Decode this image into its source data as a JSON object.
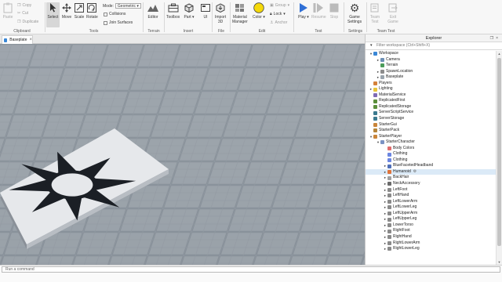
{
  "ribbon": {
    "clipboard": {
      "label": "Clipboard",
      "paste": "Paste",
      "copy": "Copy",
      "cut": "Cut",
      "duplicate": "Duplicate"
    },
    "tools": {
      "label": "Tools",
      "select": "Select",
      "move": "Move",
      "scale": "Scale",
      "rotate": "Rotate",
      "mode_label": "Mode:",
      "mode_value": "Geometric",
      "collisions": "Collisions",
      "join_surfaces": "Join Surfaces"
    },
    "terrain": {
      "label": "Terrain",
      "editor": "Editor"
    },
    "insert": {
      "label": "Insert",
      "toolbox": "Toolbox",
      "part": "Part",
      "ui": "UI"
    },
    "file": {
      "label": "File",
      "import3d_line1": "Import",
      "import3d_line2": "3D"
    },
    "edit": {
      "label": "Edit",
      "material_line1": "Material",
      "material_line2": "Manager",
      "color": "Color",
      "group": "Group",
      "lock": "Lock",
      "anchor": "Anchor"
    },
    "test": {
      "label": "Test",
      "play": "Play",
      "resume": "Resume",
      "stop": "Stop"
    },
    "settings": {
      "label": "Settings",
      "game_line1": "Game",
      "game_line2": "Settings"
    },
    "team_test": {
      "label": "Team Test",
      "team_line1": "Team",
      "team_line2": "Test",
      "exit_line1": "Exit",
      "exit_line2": "Game"
    },
    "colors": {
      "play_blue": "#2f6fd6",
      "color_yellow": "#f5d90a",
      "select_bg": "#d7d7d7"
    }
  },
  "document_tab": {
    "label": "Baseplate"
  },
  "explorer": {
    "title": "Explorer",
    "filter_placeholder": "Filter workspace (Ctrl+Shift+X)",
    "items": [
      {
        "label": "Workspace",
        "depth": 0,
        "toggle": "▾",
        "icon": "#3a87d6"
      },
      {
        "label": "Camera",
        "depth": 1,
        "toggle": "▸",
        "icon": "#6d8fb5"
      },
      {
        "label": "Terrain",
        "depth": 1,
        "toggle": "",
        "icon": "#4c9c5a"
      },
      {
        "label": "SpawnLocation",
        "depth": 1,
        "toggle": "▸",
        "icon": "#8c8c8c"
      },
      {
        "label": "Baseplate",
        "depth": 1,
        "toggle": "▸",
        "icon": "#9aa4ad"
      },
      {
        "label": "Players",
        "depth": 0,
        "toggle": "",
        "icon": "#d4813a"
      },
      {
        "label": "Lighting",
        "depth": 0,
        "toggle": "▸",
        "icon": "#e8c53a"
      },
      {
        "label": "MaterialService",
        "depth": 0,
        "toggle": "",
        "icon": "#7f6bb5"
      },
      {
        "label": "ReplicatedFirst",
        "depth": 0,
        "toggle": "",
        "icon": "#5b8f3c"
      },
      {
        "label": "ReplicatedStorage",
        "depth": 0,
        "toggle": "",
        "icon": "#5b8f3c"
      },
      {
        "label": "ServerScriptService",
        "depth": 0,
        "toggle": "",
        "icon": "#3c7a8f"
      },
      {
        "label": "ServerStorage",
        "depth": 0,
        "toggle": "",
        "icon": "#3c7a8f"
      },
      {
        "label": "StarterGui",
        "depth": 0,
        "toggle": "",
        "icon": "#c9853a"
      },
      {
        "label": "StarterPack",
        "depth": 0,
        "toggle": "",
        "icon": "#b5853a"
      },
      {
        "label": "StarterPlayer",
        "depth": 0,
        "toggle": "▾",
        "icon": "#c9853a"
      },
      {
        "label": "StarterCharacter",
        "depth": 1,
        "toggle": "▾",
        "icon": "#7c93c4"
      },
      {
        "label": "Body Colors",
        "depth": 2,
        "toggle": "",
        "icon": "#e06c6c"
      },
      {
        "label": "Clothing",
        "depth": 2,
        "toggle": "",
        "icon": "#6c86e0"
      },
      {
        "label": "Clothing",
        "depth": 2,
        "toggle": "",
        "icon": "#6c86e0"
      },
      {
        "label": "BlueFacetedHeadband",
        "depth": 2,
        "toggle": "▸",
        "icon": "#4f6fb8"
      },
      {
        "label": "Humanoid",
        "depth": 2,
        "toggle": "▸",
        "icon": "#e0743a",
        "selected": true,
        "gear": "⚙"
      },
      {
        "label": "BackHair",
        "depth": 2,
        "toggle": "▸",
        "icon": "#a0a0a0"
      },
      {
        "label": "NeckAccessory",
        "depth": 2,
        "toggle": "▸",
        "icon": "#6b6b6b"
      },
      {
        "label": "LeftFoot",
        "depth": 2,
        "toggle": "▸",
        "icon": "#8a8a8a"
      },
      {
        "label": "LeftHand",
        "depth": 2,
        "toggle": "▸",
        "icon": "#8a8a8a"
      },
      {
        "label": "LeftLowerArm",
        "depth": 2,
        "toggle": "▸",
        "icon": "#8a8a8a"
      },
      {
        "label": "LeftLowerLeg",
        "depth": 2,
        "toggle": "▸",
        "icon": "#8a8a8a"
      },
      {
        "label": "LeftUpperArm",
        "depth": 2,
        "toggle": "▸",
        "icon": "#8a8a8a"
      },
      {
        "label": "LeftUpperLeg",
        "depth": 2,
        "toggle": "▸",
        "icon": "#8a8a8a"
      },
      {
        "label": "LowerTorso",
        "depth": 2,
        "toggle": "▸",
        "icon": "#8a8a8a"
      },
      {
        "label": "RightFoot",
        "depth": 2,
        "toggle": "▸",
        "icon": "#8a8a8a"
      },
      {
        "label": "RightHand",
        "depth": 2,
        "toggle": "▸",
        "icon": "#8a8a8a"
      },
      {
        "label": "RightLowerArm",
        "depth": 2,
        "toggle": "▸",
        "icon": "#8a8a8a"
      },
      {
        "label": "RightLowerLeg",
        "depth": 2,
        "toggle": "▸",
        "icon": "#8a8a8a"
      }
    ]
  },
  "command_bar": {
    "placeholder": "Run a command"
  }
}
